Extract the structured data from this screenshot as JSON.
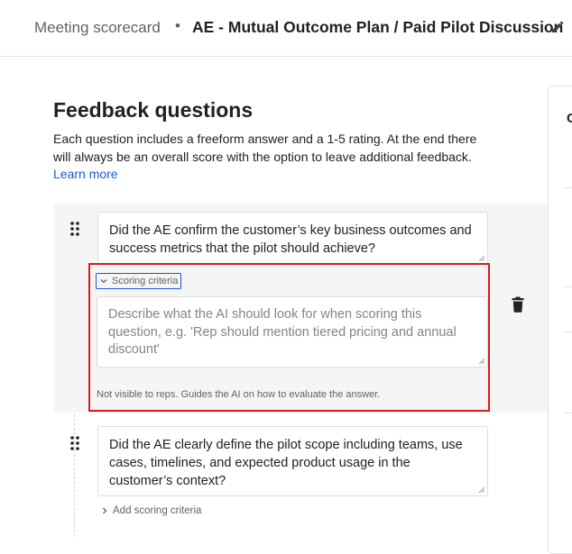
{
  "header": {
    "breadcrumb_parent": "Meeting scorecard",
    "separator": "•",
    "title": "AE - Mutual Outcome Plan / Paid Pilot Discussion"
  },
  "section": {
    "title": "Feedback questions",
    "description": "Each question includes a freeform answer and a 1-5 rating. At the end there will always be an overall score with the option to leave additional feedback.",
    "learn_more": "Learn more"
  },
  "questions": [
    {
      "text": "Did the AE confirm the customer’s key business outcomes and success metrics that the pilot should achieve?",
      "scoring_toggle_label": "Scoring criteria",
      "criteria_placeholder": "Describe what the AI should look for when scoring this question, e.g. 'Rep should mention tiered pricing and annual discount'",
      "helper_text": "Not visible to reps. Guides the AI on how to evaluate the answer."
    },
    {
      "text": "Did the AE clearly define the pilot scope including teams, use cases, timelines, and expected product usage in the customer’s context?",
      "add_criteria_label": "Add scoring criteria"
    }
  ],
  "right_panel": {
    "label": "C"
  },
  "icons": {
    "edit": "pencil-icon",
    "drag": "drag-handle-icon",
    "expand": "chevron-down-icon",
    "collapsed": "chevron-right-icon",
    "delete": "trash-icon"
  },
  "colors": {
    "link": "#1a57d8",
    "highlight": "#d81b1b",
    "card_background": "#f5f5f5"
  }
}
